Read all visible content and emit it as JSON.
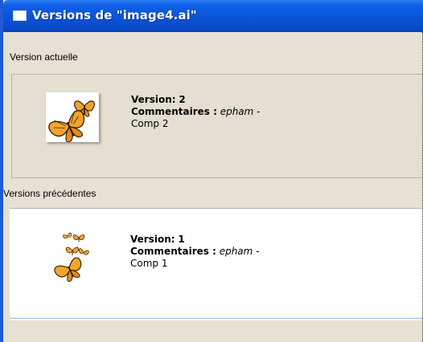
{
  "window": {
    "title": "Versions de \"image4.ai\""
  },
  "current": {
    "section_label": "Version actuelle",
    "version_label": "Version:",
    "version_value": "2",
    "comments_label": "Commentaires :",
    "comments_author": "epham",
    "comments_sep": "-",
    "comment_text": "Comp 2"
  },
  "previous": {
    "section_label": "Versions précédentes",
    "items": [
      {
        "version_label": "Version:",
        "version_value": "1",
        "comments_label": "Commentaires :",
        "comments_author": "epham",
        "comments_sep": "-",
        "comment_text": "Comp 1"
      }
    ]
  },
  "icons": {
    "title_icon": "window-icon",
    "current_thumb": "butterfly-thumbnail-icon",
    "previous_thumb": "butterflies-thumbnail-icon"
  }
}
